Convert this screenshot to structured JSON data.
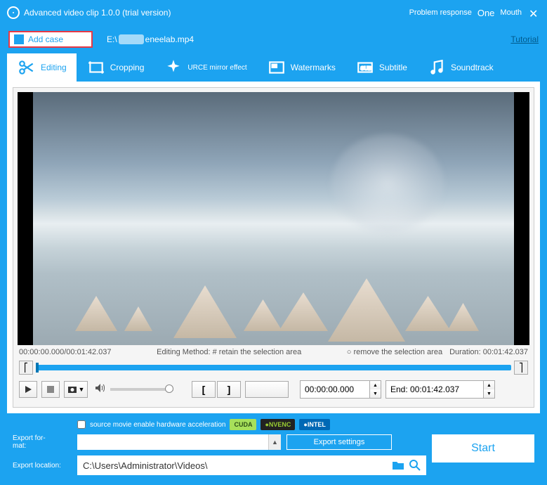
{
  "titlebar": {
    "app_title": "Advanced video clip 1.0.0 (trial version)",
    "problem_response": "Problem response",
    "one": "One",
    "mouth": "Mouth"
  },
  "toolbar": {
    "add_case": "Add case",
    "path_prefix": "E:\\",
    "path_suffix": "eneelab.mp4",
    "tutorial": "Tutorial"
  },
  "tabs": {
    "editing": "Editing",
    "cropping": "Cropping",
    "effects": "URCE mirror effect",
    "watermarks": "Watermarks",
    "subtitle": "Subtitle",
    "soundtrack": "Soundtrack"
  },
  "preview": {
    "position": "00:00:00.000/00:01:42.037",
    "method_label": "Editing Method: # retain the selection area",
    "method_remove": "○ remove the selection area",
    "duration": "Duration: 00:01:42.037",
    "start_time": "00:00:00.000",
    "end_label": "End: 00:01:42.037"
  },
  "bottom": {
    "hw_text": "source movie enable hardware acceleration",
    "cuda": "CUDA",
    "nvenc": "NVENC",
    "intel": "INTEL",
    "export_format_label": "Export for-\nmat:",
    "export_settings": "Export settings",
    "start": "Start",
    "export_location_label": "Export location:",
    "export_location": "C:\\Users\\Administrator\\Videos\\"
  }
}
